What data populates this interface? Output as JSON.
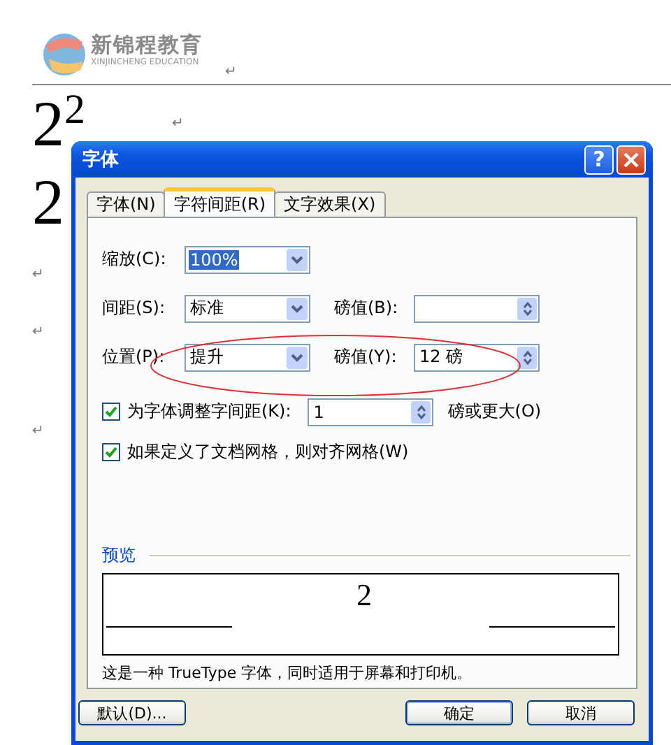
{
  "logo": {
    "name": "新锦程教育",
    "tagline": "XINJINCHENG EDUCATION"
  },
  "document": {
    "base": "2",
    "superscript": "2",
    "second": "2",
    "marks": [
      "↵",
      "↵",
      "↵",
      "↵",
      "↵"
    ]
  },
  "dialog": {
    "title": "字体",
    "help": "?",
    "tabs": [
      {
        "label": "字体(N)",
        "selected": false
      },
      {
        "label": "字符间距(R)",
        "selected": true
      },
      {
        "label": "文字效果(X)",
        "selected": false
      }
    ],
    "scale": {
      "label": "缩放(C):",
      "value": "100%",
      "text_selected": true
    },
    "spacing": {
      "label": "间距(S):",
      "value": "标准",
      "points_label": "磅值(B):"
    },
    "position": {
      "label": "位置(P):",
      "value": "提升",
      "points_label": "磅值(Y):",
      "points_value": "12 磅"
    },
    "kerning": {
      "label": "为字体调整字间距(K):",
      "checked": true,
      "value": "1",
      "suffix": "磅或更大(O)"
    },
    "grid": {
      "label": "如果定义了文档网格，则对齐网格(W)",
      "checked": true
    },
    "preview": {
      "label": "预览",
      "sample": "2"
    },
    "description": "这是一种 TrueType 字体，同时适用于屏幕和打印机。",
    "buttons": [
      {
        "label": "默认(D)...",
        "default": false
      },
      {
        "label": "确定",
        "default": true
      },
      {
        "label": "取消",
        "default": false
      }
    ]
  }
}
